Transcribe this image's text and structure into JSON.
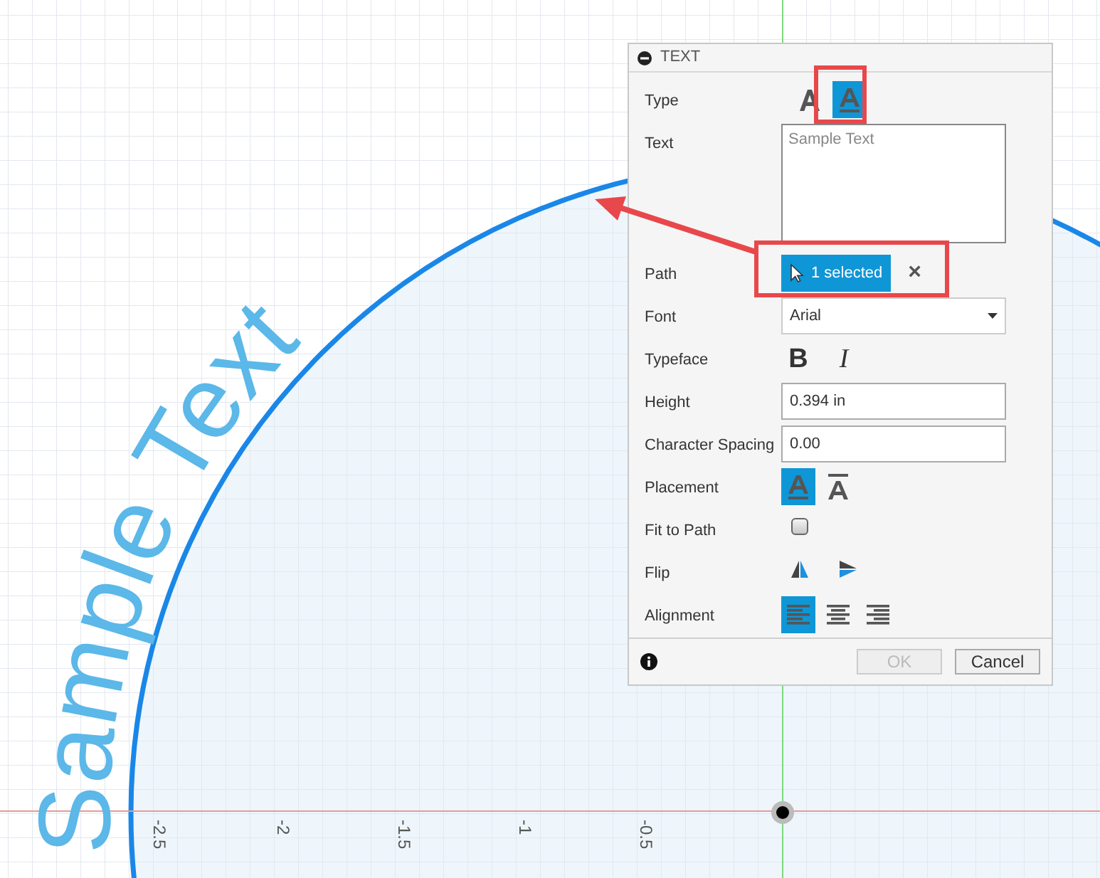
{
  "canvas": {
    "sample_text": "Sample Text",
    "axis_labels": [
      "-2.5",
      "-2",
      "-1.5",
      "-1",
      "-0.5"
    ]
  },
  "dialog": {
    "title": "TEXT",
    "type": {
      "label": "Type",
      "options": [
        {
          "kind": "plain",
          "selected": false
        },
        {
          "kind": "path",
          "selected": true
        }
      ]
    },
    "text": {
      "label": "Text",
      "placeholder": "Sample Text"
    },
    "path": {
      "label": "Path",
      "value": "1 selected",
      "clear": "×"
    },
    "font": {
      "label": "Font",
      "value": "Arial"
    },
    "typeface": {
      "label": "Typeface",
      "bold": "B",
      "italic": "I"
    },
    "height": {
      "label": "Height",
      "value": "0.394 in"
    },
    "character_spacing": {
      "label": "Character Spacing",
      "value": "0.00"
    },
    "placement": {
      "label": "Placement",
      "options": [
        {
          "kind": "below",
          "selected": true
        },
        {
          "kind": "above",
          "selected": false
        }
      ]
    },
    "fit_to_path": {
      "label": "Fit to Path",
      "checked": false
    },
    "flip": {
      "label": "Flip"
    },
    "alignment": {
      "label": "Alignment",
      "options": [
        {
          "kind": "left",
          "selected": true
        },
        {
          "kind": "center",
          "selected": false
        },
        {
          "kind": "right",
          "selected": false
        }
      ]
    },
    "buttons": [
      {
        "label": "OK",
        "disabled": true
      },
      {
        "label": "Cancel",
        "disabled": false
      }
    ]
  }
}
